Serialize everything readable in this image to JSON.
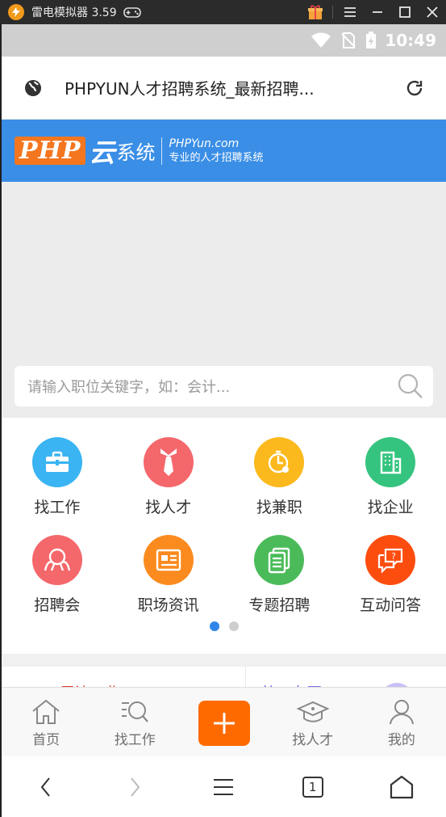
{
  "emulator": {
    "title": "雷电模拟器 3.59"
  },
  "status": {
    "time": "10:49"
  },
  "browser": {
    "page_title": "PHPYUN人才招聘系统_最新招聘..."
  },
  "banner": {
    "logo_php": "PHP",
    "logo_yun": "云",
    "logo_system": "系统",
    "domain": "PHPYun.com",
    "slogan": "专业的人才招聘系统"
  },
  "search": {
    "placeholder": "请输入职位关键字，如：会计..."
  },
  "menu": {
    "row1": [
      {
        "label": "找工作",
        "color": "#3ab4f2",
        "icon": "briefcase-icon"
      },
      {
        "label": "找人才",
        "color": "#f4676b",
        "icon": "tie-icon"
      },
      {
        "label": "找兼职",
        "color": "#fcb91d",
        "icon": "timer-icon"
      },
      {
        "label": "找企业",
        "color": "#35c47f",
        "icon": "building-icon"
      }
    ],
    "row2": [
      {
        "label": "招聘会",
        "color": "#f4676b",
        "icon": "handshake-icon"
      },
      {
        "label": "职场资讯",
        "color": "#fb8b1f",
        "icon": "news-icon"
      },
      {
        "label": "专题招聘",
        "color": "#4bbb5a",
        "icon": "documents-icon"
      },
      {
        "label": "互动问答",
        "color": "#fc4d0f",
        "icon": "question-bubble-icon"
      }
    ]
  },
  "pager": {
    "pages": 2,
    "active": 0
  },
  "cards": {
    "left": "周边工作",
    "right": "普工专区"
  },
  "tabbar": {
    "home": "首页",
    "find_job": "找工作",
    "find_talent": "找人才",
    "mine": "我的"
  },
  "navbar": {
    "tab_count": "1"
  }
}
